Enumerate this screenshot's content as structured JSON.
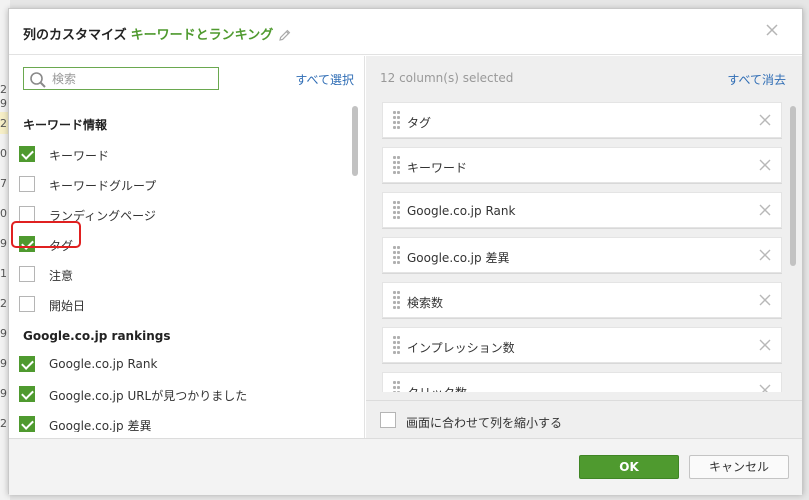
{
  "background": {
    "row_numbers": [
      "2",
      "9",
      "2",
      "0",
      "7",
      "0",
      "9",
      "1",
      "2",
      "9",
      "9",
      "9",
      "2"
    ]
  },
  "dialog": {
    "title": "列のカスタマイズ",
    "title_accent": "キーワードとランキング",
    "accent_color": "#4f9a2f"
  },
  "left_panel": {
    "search": {
      "placeholder": "検索",
      "value": ""
    },
    "select_all_label": "すべて選択",
    "sections": [
      {
        "title": "キーワード情報",
        "items": [
          {
            "label": "キーワード",
            "checked": true
          },
          {
            "label": "キーワードグループ",
            "checked": false
          },
          {
            "label": "ランディングページ",
            "checked": false
          },
          {
            "label": "タグ",
            "checked": true
          },
          {
            "label": "注意",
            "checked": false
          },
          {
            "label": "開始日",
            "checked": false
          }
        ]
      },
      {
        "title": "Google.co.jp rankings",
        "items": [
          {
            "label": "Google.co.jp Rank",
            "checked": true
          },
          {
            "label": "Google.co.jp URLが見つかりました",
            "checked": true
          },
          {
            "label": "Google.co.jp 差異",
            "checked": true
          }
        ]
      }
    ]
  },
  "right_panel": {
    "count_text": "12 column(s) selected",
    "clear_all_label": "すべて消去",
    "selected_columns": [
      "タグ",
      "キーワード",
      "Google.co.jp Rank",
      "Google.co.jp 差異",
      "検索数",
      "インプレッション数",
      "クリック数"
    ],
    "shrink_to_fit": {
      "label": "画面に合わせて列を縮小する",
      "checked": false
    }
  },
  "footer": {
    "ok_label": "OK",
    "cancel_label": "キャンセル"
  },
  "icons": {
    "title_edit": "pencil-icon",
    "close": "close-icon",
    "search": "search-icon",
    "drag": "drag-handle-icon",
    "remove": "remove-icon"
  }
}
